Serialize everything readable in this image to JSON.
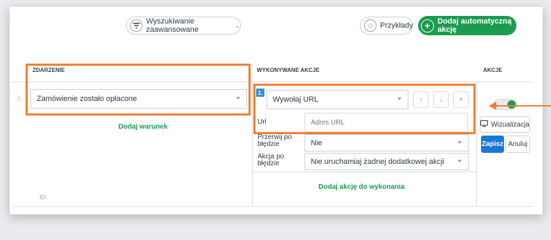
{
  "toolbar": {
    "advanced_search_label": "Wyszukiwanie zaawansowane",
    "examples_label": "Przykłady",
    "add_action_label": "Dodaj automatyczną akcję"
  },
  "table": {
    "columns": {
      "event": "ZDARZENIE",
      "performed_actions": "WYKONYWANE AKCJE",
      "actions": "AKCJE"
    },
    "event": {
      "selected": "Zamówienie zostało opłacone",
      "add_condition_label": "Dodaj warunek",
      "id_label": "ID:"
    },
    "action_item": {
      "number": "1.",
      "type_selected": "Wywołaj URL",
      "url_label": "Url",
      "url_placeholder": "Adres URL",
      "stop_on_error_label": "Przerwij po błędzie",
      "stop_on_error_value": "Nie",
      "action_on_error_label": "Akcja po błędzie",
      "action_on_error_value": "Nie uruchamiaj żadnej dodatkowej akcji"
    },
    "add_action_label": "Dodaj akcję do wykonania",
    "side": {
      "preview_label": "Wizualizacja",
      "save_label": "Zapisz",
      "cancel_label": "Anuluj"
    }
  },
  "colors": {
    "primary_green": "#1b9b4f",
    "primary_blue": "#1979d4",
    "highlight_orange": "#ef7f2f"
  }
}
